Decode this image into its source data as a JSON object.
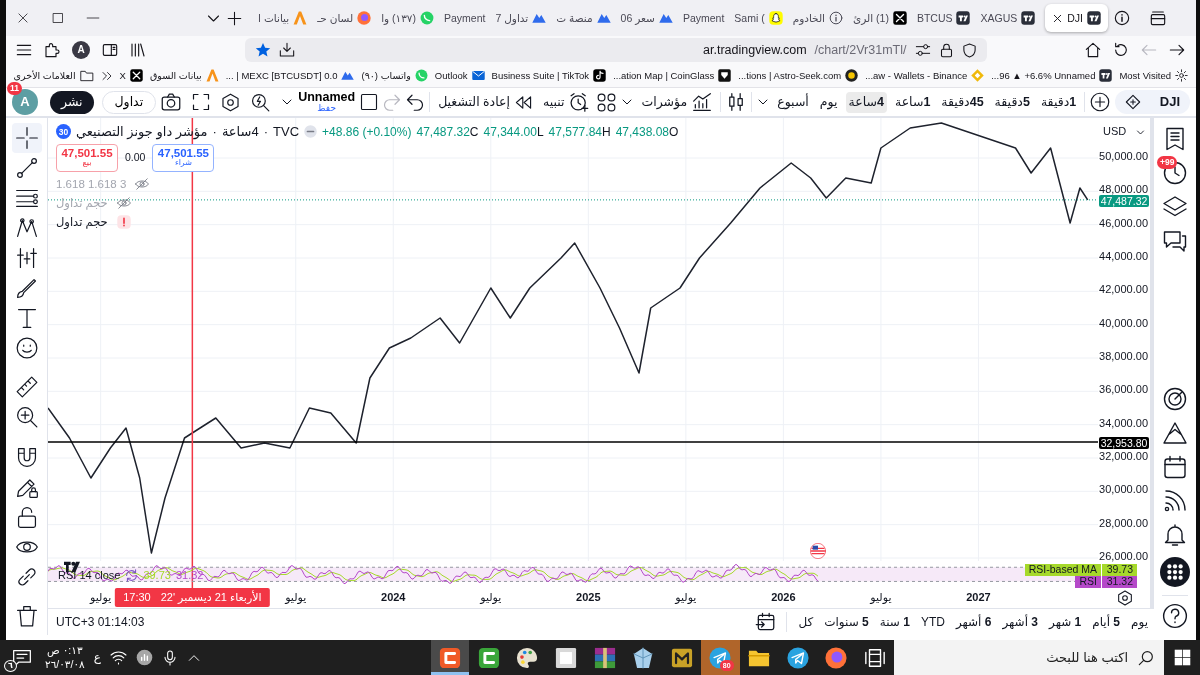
{
  "browser": {
    "tabs": [
      {
        "title": "DJI",
        "kind": "tv",
        "selected": true
      },
      {
        "title": "XAGUS",
        "kind": "tv",
        "selected": false
      },
      {
        "title": "BTCUS",
        "kind": "tv",
        "selected": false
      },
      {
        "title": "(1) الرئ",
        "kind": "x",
        "selected": false
      },
      {
        "title": "الخادوم",
        "kind": "info",
        "selected": false
      },
      {
        "title": "Sami (",
        "kind": "ghost",
        "selected": false
      },
      {
        "title": "Payment",
        "kind": "blank",
        "selected": false
      },
      {
        "title": "سعر 06",
        "kind": "peaks",
        "selected": false
      },
      {
        "title": "منصة ت",
        "kind": "peaks",
        "selected": false
      },
      {
        "title": "تداول 7",
        "kind": "peaks",
        "selected": false
      },
      {
        "title": "Payment",
        "kind": "blank",
        "selected": false
      },
      {
        "title": "(١٣٧) وا",
        "kind": "chat",
        "selected": false
      },
      {
        "title": "لسان حـ",
        "kind": "fox",
        "selected": false
      },
      {
        "title": "بيانات ا",
        "kind": "letter",
        "selected": false
      }
    ],
    "nav": {
      "history": [
        {
          "kind": "back",
          "disabled": false
        },
        {
          "kind": "forward",
          "disabled": true
        }
      ],
      "url_host": "ar.tradingview.com",
      "url_path": "/chart/2Vr31mTl/",
      "bookmarked": true,
      "account_initial": "A"
    },
    "bookmarks": [
      {
        "title": "Most Visited",
        "kind": "gear"
      },
      {
        "title": "...96 ▲ +6.6% Unnamed",
        "kind": "tv"
      },
      {
        "title": "...aw - Wallets - Binance",
        "kind": "diamond"
      },
      {
        "title": "...tions | Astro-Seek.com",
        "kind": "astro"
      },
      {
        "title": "...ation Map | CoinGlass",
        "kind": "sqlogo"
      },
      {
        "title": "Business Suite | TikTok",
        "kind": "note"
      },
      {
        "title": "Outlook",
        "kind": "envelope"
      },
      {
        "title": "واتساب (٩٠)",
        "kind": "chat"
      },
      {
        "title": "... | MEXC [BTCUSDT] 0.0",
        "kind": "peaks"
      },
      {
        "title": "بيانات السوق",
        "kind": "letter"
      },
      {
        "title": "X",
        "kind": "x"
      }
    ],
    "other_bookmarks": "العلامات الأخرى"
  },
  "toolbar": {
    "symbol": "DJI",
    "intervals": [
      {
        "label": "**1**دقيقة",
        "selected": false
      },
      {
        "label": "**5**دقيقة",
        "selected": false
      },
      {
        "label": "**45**دقيقة",
        "selected": false
      },
      {
        "label": "**1**ساعة",
        "selected": false
      },
      {
        "label": "**4**ساعة",
        "selected": true
      },
      {
        "label": "يوم",
        "selected": false
      },
      {
        "label": "أسبوع",
        "selected": false
      }
    ],
    "indicators": "مؤشرات",
    "alert": "تنبيه",
    "replay": "إعادة التشغيل",
    "undo_disabled": false,
    "redo_disabled": true,
    "layout_name": "Unnamed",
    "save": "حفظ",
    "trade": "تداول",
    "publish": "نشر",
    "avatar_initial": "A",
    "avatar_badge": "11"
  },
  "drawing_tools": [
    {
      "kind": "crosshair",
      "selected": true
    },
    {
      "kind": "trendline",
      "selected": false
    },
    {
      "kind": "fib",
      "selected": false
    },
    {
      "kind": "pattern",
      "selected": false
    },
    {
      "kind": "prediction",
      "selected": false
    },
    {
      "kind": "brush",
      "selected": false
    },
    {
      "kind": "text",
      "selected": false
    },
    {
      "kind": "smiley",
      "selected": false
    },
    {
      "kind": "ruler",
      "selected": false
    },
    {
      "kind": "zoom",
      "selected": false
    },
    {
      "kind": "magnet",
      "selected": false
    },
    {
      "kind": "pencil_lock",
      "selected": false
    },
    {
      "kind": "lock",
      "selected": false
    },
    {
      "kind": "eye",
      "selected": false
    },
    {
      "kind": "link",
      "selected": false
    },
    {
      "kind": "trash",
      "selected": false
    }
  ],
  "legend": {
    "badge": "30",
    "title": [
      "TVC",
      "·",
      "4ساعة",
      "·",
      "مؤشر داو جونز التصنيعي"
    ],
    "change": "+48.86 (+0.10%)",
    "ohlc": [
      {
        "label": "O",
        "value": "47,438.08"
      },
      {
        "label": "H",
        "value": "47,577.84"
      },
      {
        "label": "L",
        "value": "47,344.00"
      },
      {
        "label": "C",
        "value": "47,487.32"
      }
    ],
    "sell": {
      "price": "47,501.55",
      "label": "بيع"
    },
    "spread": "0.00",
    "buy": {
      "price": "47,501.55",
      "label": "شراء"
    },
    "indicators": [
      {
        "label": "1.618 1.618 3",
        "hidden": true,
        "error": false
      },
      {
        "label": "حجم تداول",
        "hidden": true,
        "error": false
      },
      {
        "label": "حجم تداول",
        "hidden": false,
        "error": true
      }
    ]
  },
  "chart": {
    "crosshair_time": "17:30",
    "chart_data": {
      "type": "line",
      "x": [
        2022.23,
        2022.34,
        2022.45,
        2022.55,
        2022.63,
        2022.7,
        2022.76,
        2022.83,
        2022.93,
        2023.01,
        2023.09,
        2023.22,
        2023.34,
        2023.47,
        2023.57,
        2023.68,
        2023.81,
        2023.88,
        2023.98,
        2024.09,
        2024.24,
        2024.34,
        2024.5,
        2024.6,
        2024.7,
        2024.86,
        2024.93,
        2025.06,
        2025.16,
        2025.26,
        2025.32,
        2025.47,
        2025.57,
        2025.73,
        2025.88,
        2026.04,
        2026.14,
        2026.22,
        2026.32,
        2026.45,
        2026.5,
        2026.65,
        2026.81,
        2027.19,
        2027.27,
        2027.37,
        2027.47,
        2027.52,
        2027.56
      ],
      "series": [
        {
          "color": "#1e222d",
          "values": [
            35000,
            33200,
            30800,
            32600,
            33800,
            30800,
            26300,
            29600,
            33200,
            33800,
            34400,
            32600,
            32900,
            32600,
            35000,
            34700,
            32900,
            36800,
            38600,
            39200,
            40400,
            38900,
            42200,
            40400,
            42200,
            44000,
            44900,
            42200,
            39800,
            37100,
            41000,
            42200,
            44000,
            46100,
            48200,
            49700,
            48800,
            47600,
            48800,
            48500,
            50600,
            51800,
            52100,
            50600,
            49100,
            50600,
            46100,
            48200,
            47490
          ]
        }
      ],
      "xlim": [
        2022.23,
        2027.9
      ],
      "ylim": [
        23000,
        52400
      ],
      "grid": true,
      "xticks": [
        {
          "value": 2022.5,
          "label": "يوليو"
        },
        {
          "value": 2023.5,
          "label": "يوليو"
        },
        {
          "value": 2024,
          "label": "2024"
        },
        {
          "value": 2024.5,
          "label": "يوليو"
        },
        {
          "value": 2025,
          "label": "2025"
        },
        {
          "value": 2025.5,
          "label": "يوليو"
        },
        {
          "value": 2026,
          "label": "2026"
        },
        {
          "value": 2026.5,
          "label": "يوليو"
        },
        {
          "value": 2027,
          "label": "2027"
        }
      ],
      "yticks": [
        {
          "value": 26000,
          "label": "26,000.00"
        },
        {
          "value": 28000,
          "label": "28,000.00"
        },
        {
          "value": 30000,
          "label": "30,000.00"
        },
        {
          "value": 32000,
          "label": "32,000.00"
        },
        {
          "value": 34000,
          "label": "34,000.00"
        },
        {
          "value": 36000,
          "label": "36,000.00"
        },
        {
          "value": 38000,
          "label": "38,000.00"
        },
        {
          "value": 40000,
          "label": "40,000.00"
        },
        {
          "value": 42000,
          "label": "42,000.00"
        },
        {
          "value": 44000,
          "label": "44,000.00"
        },
        {
          "value": 46000,
          "label": "46,000.00"
        },
        {
          "value": 48000,
          "label": "48,000.00"
        },
        {
          "value": 50000,
          "label": "50,000.00"
        }
      ],
      "ref_lines": [
        {
          "axis": "y",
          "value": 47487.32,
          "label": "47,487.32",
          "color": "#089981"
        },
        {
          "axis": "y",
          "value": 32953.8,
          "label": "32,953.80",
          "color": "#000000"
        },
        {
          "axis": "x",
          "value": 2022.97,
          "label": "الأربعاء 21 ديسمبر '22",
          "color": "#f23645"
        }
      ]
    }
  },
  "price_axis": {
    "currency": "USD"
  },
  "rsi": {
    "label": "RSI 14 close",
    "legend_values": [
      {
        "text": "31.32",
        "color": "#b549c9"
      },
      {
        "text": "39.73",
        "color": "#a6d92b"
      }
    ],
    "lines": [
      {
        "name": "RSI-based MA",
        "color": "#a6d92b",
        "value": "39.73"
      },
      {
        "name": "RSI",
        "color": "#b549c9",
        "value": "31.32"
      }
    ]
  },
  "bottom_bar": {
    "clock": "UTC+3 01:14:03",
    "ranges": [
      "يوم",
      "**5** أيام",
      "**1** شهر",
      "**3** أشهر",
      "**6** أشهر",
      "YTD",
      "**1** سنة",
      "**5** سنوات",
      "كل"
    ]
  },
  "widgets_top": [
    {
      "kind": "watchlist"
    },
    {
      "kind": "alerts",
      "badge": "+99"
    },
    {
      "kind": "layers"
    },
    {
      "kind": "chat"
    }
  ],
  "widgets_bottom": [
    {
      "kind": "target"
    },
    {
      "kind": "peaks"
    },
    {
      "kind": "calendar"
    },
    {
      "kind": "broadcast"
    },
    {
      "kind": "bell"
    },
    {
      "kind": "apps"
    }
  ],
  "taskbar": {
    "search_placeholder": "اكتب هنا للبحث",
    "apps": [
      {
        "kind": "taskview",
        "selected": false,
        "flashing": false
      },
      {
        "kind": "fox",
        "selected": false,
        "flashing": false
      },
      {
        "kind": "plane",
        "selected": false,
        "flashing": false
      },
      {
        "kind": "folder",
        "selected": false,
        "flashing": false
      },
      {
        "kind": "plane",
        "selected": false,
        "flashing": true,
        "badge": "80"
      },
      {
        "kind": "m",
        "selected": false,
        "flashing": false
      },
      {
        "kind": "crystal",
        "selected": false,
        "flashing": false
      },
      {
        "kind": "books",
        "selected": false,
        "flashing": false
      },
      {
        "kind": "tile",
        "selected": false,
        "flashing": false
      },
      {
        "kind": "palette",
        "selected": false,
        "flashing": false
      },
      {
        "kind": "c_green",
        "selected": false,
        "flashing": false
      },
      {
        "kind": "c_orange",
        "selected": true,
        "flashing": false
      }
    ],
    "language": "ع",
    "time": "٠:١٣ ص",
    "date": "٢٦/٠٣/٠٨",
    "notification_badge": "٦"
  }
}
